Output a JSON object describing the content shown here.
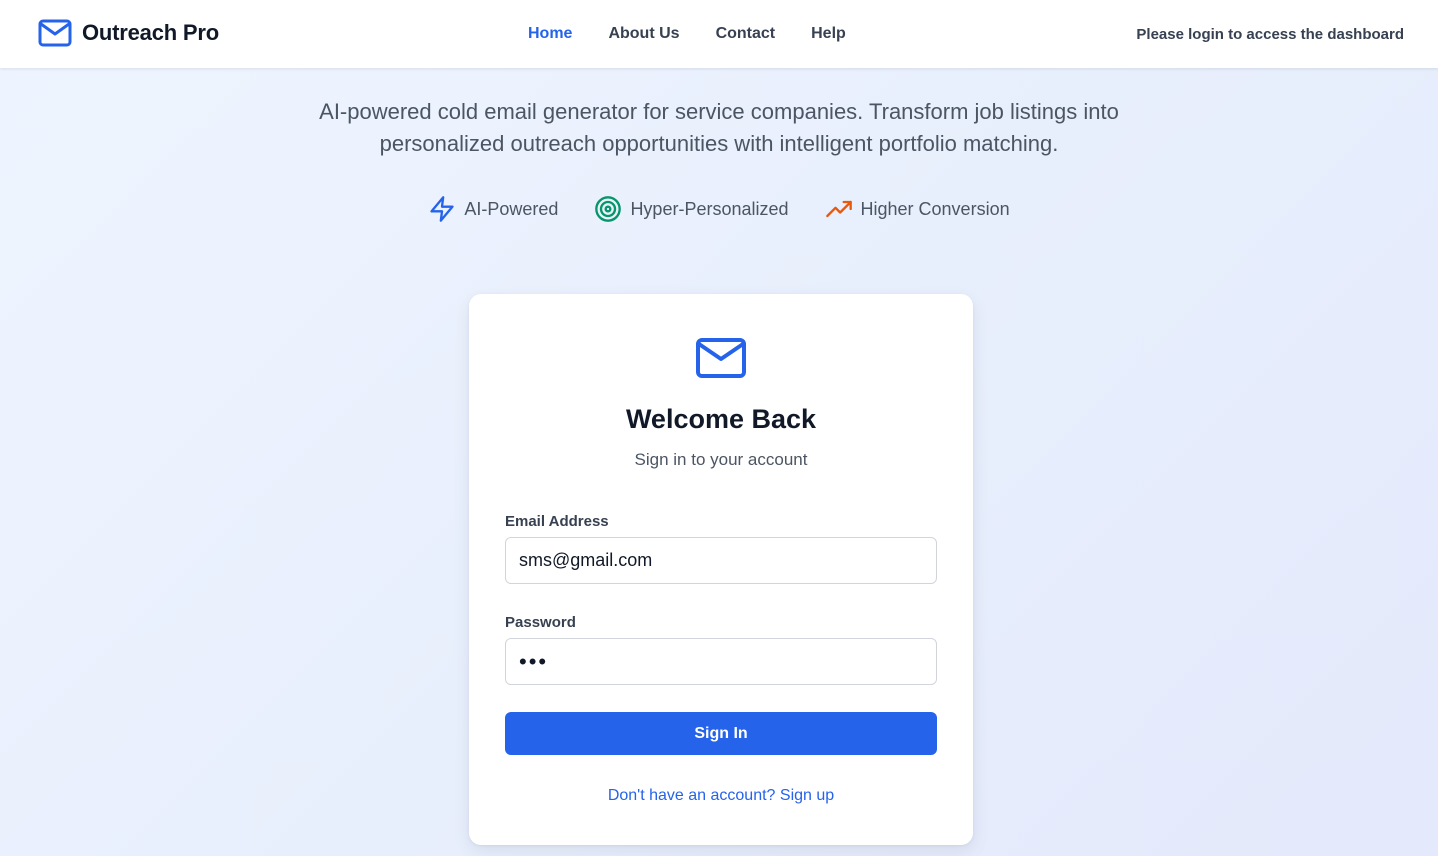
{
  "brand": {
    "name": "Outreach Pro",
    "icon": "mail-icon",
    "color": "#2563eb"
  },
  "nav": {
    "items": [
      {
        "label": "Home",
        "active": true
      },
      {
        "label": "About Us",
        "active": false
      },
      {
        "label": "Contact",
        "active": false
      },
      {
        "label": "Help",
        "active": false
      }
    ]
  },
  "header": {
    "login_note": "Please login to access the dashboard"
  },
  "hero": {
    "tagline_line1": "AI-powered cold email generator for service companies. Transform job listings into",
    "tagline_line2": "personalized outreach opportunities with intelligent portfolio matching.",
    "features": [
      {
        "label": "AI-Powered",
        "icon": "lightning-icon",
        "color": "#2563eb"
      },
      {
        "label": "Hyper-Personalized",
        "icon": "target-icon",
        "color": "#059669"
      },
      {
        "label": "Higher Conversion",
        "icon": "trending-up-icon",
        "color": "#ea580c"
      }
    ]
  },
  "login": {
    "icon": "mail-icon",
    "title": "Welcome Back",
    "subtitle": "Sign in to your account",
    "email_label": "Email Address",
    "email_value": "sms@gmail.com",
    "password_label": "Password",
    "password_value": "•••",
    "submit_label": "Sign In",
    "signup_text": "Don't have an account? Sign up"
  },
  "colors": {
    "accent": "#2563eb",
    "text_dark": "#111827",
    "text_muted": "#4b5563"
  }
}
